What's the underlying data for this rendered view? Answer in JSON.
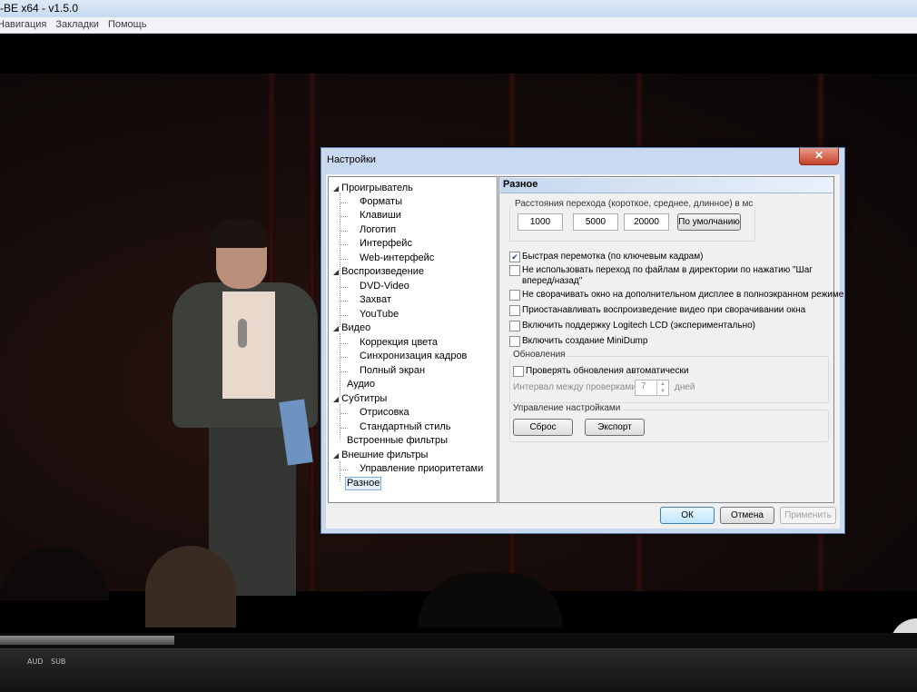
{
  "app": {
    "title": "-BE x64 - v1.5.0"
  },
  "menu": [
    "Навигация",
    "Закладки",
    "Помощь"
  ],
  "controls": {
    "aud_label": "AUD",
    "sub_label": "SUB",
    "seek_progress": 0.19
  },
  "dialog": {
    "title": "Настройки",
    "close_label": "✕",
    "tree": {
      "p1": "Проигрыватель",
      "p1_formats": "Форматы",
      "p1_keys": "Клавиши",
      "p1_logo": "Логотип",
      "p1_interface": "Интерфейс",
      "p1_web": "Web-интерфейс",
      "p2": "Воспроизведение",
      "p2_dvd": "DVD-Video",
      "p2_capture": "Захват",
      "p2_youtube": "YouTube",
      "p3": "Видео",
      "p3_color": "Коррекция цвета",
      "p3_sync": "Синхронизация кадров",
      "p3_full": "Полный экран",
      "p4": "Аудио",
      "p5": "Субтитры",
      "p5_render": "Отрисовка",
      "p5_style": "Стандартный стиль",
      "p6": "Встроенные фильтры",
      "p7": "Внешние фильтры",
      "p7_prio": "Управление приоритетами",
      "p8": "Разное"
    },
    "panel": {
      "heading": "Разное",
      "jump_group_title": "Расстояния перехода (короткое, среднее, длинное) в мс",
      "jump_short": "1000",
      "jump_medium": "5000",
      "jump_long": "20000",
      "default_button": "По умолчанию",
      "opt_fast_seek": "Быстрая перемотка (по ключевым кадрам)",
      "opt_fast_seek_checked": "✔",
      "opt_no_file_jump": "Не использовать переход по файлам в директории по нажатию \"Шаг вперед/назад\"",
      "opt_no_minimize": "Не сворачивать окно на дополнительном дисплее в полноэкранном режиме",
      "opt_pause_minimize": "Приостанавливать воспроизведение видео при сворачивании окна",
      "opt_logitech": "Включить поддержку Logitech LCD (экспериментально)",
      "opt_minidump": "Включить создание MiniDump",
      "updates_title": "Обновления",
      "opt_check_updates": "Проверять обновления автоматически",
      "interval_label": "Интервал между проверками:",
      "interval_value": "7",
      "interval_unit": "дней",
      "manage_title": "Управление настройками",
      "reset_button": "Сброс",
      "export_button": "Экспорт"
    },
    "ok_button": "ОК",
    "cancel_button": "Отмена",
    "apply_button": "Применить"
  }
}
